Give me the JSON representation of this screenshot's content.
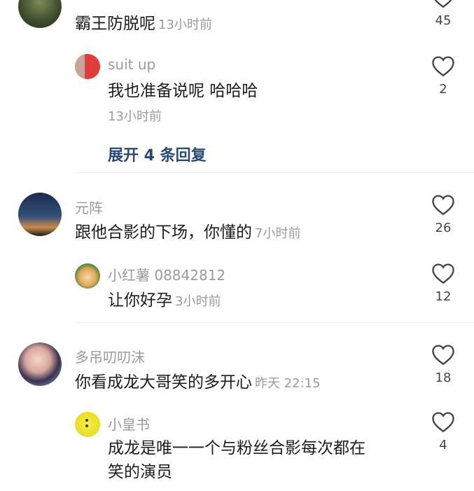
{
  "comments": [
    {
      "name": "",
      "text": "霸王防脱呢",
      "time": "13小时前",
      "likes": "45",
      "reply": {
        "name": "suit up",
        "text": "我也准备说呢 哈哈哈",
        "time": "13小时前",
        "likes": "2"
      },
      "expand_label": "展开 4 条回复"
    },
    {
      "name": "元阵",
      "text": "跟他合影的下场，你懂的",
      "time": "7小时前",
      "likes": "26",
      "reply": {
        "name": "小红薯 08842812",
        "text": "让你好孕",
        "time": "3小时前",
        "likes": "12"
      }
    },
    {
      "name": "多吊叨叨沫",
      "text": "你看成龙大哥笑的多开心",
      "time": "昨天 22:15",
      "likes": "18",
      "reply": {
        "name": "小皇书",
        "text_line1": "成龙是唯一一个与粉丝合影每次都在",
        "text_line2": "笑的演员",
        "likes": "4"
      }
    }
  ]
}
